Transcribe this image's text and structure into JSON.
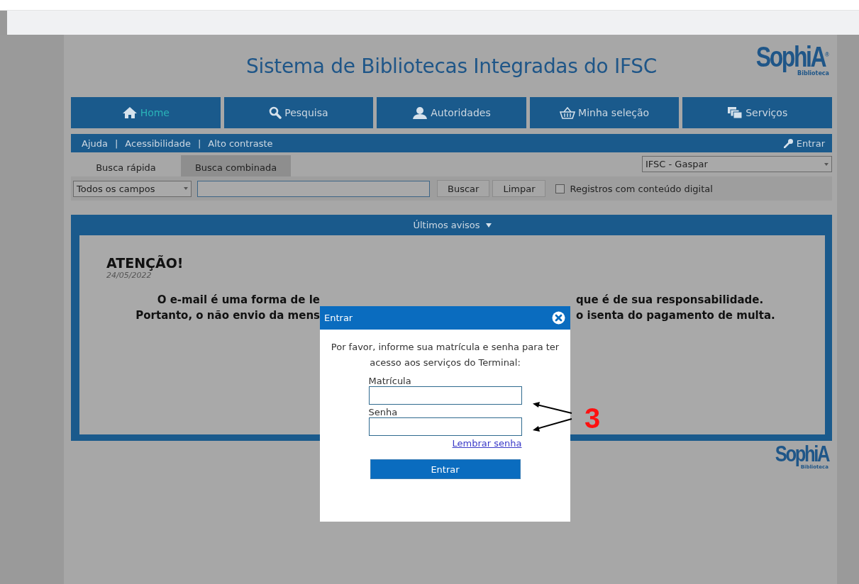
{
  "header": {
    "title": "Sistema de Bibliotecas Integradas do IFSC",
    "logo": {
      "name": "SophiA",
      "mark": "®",
      "sub": "Biblioteca"
    }
  },
  "nav": [
    {
      "label": "Home",
      "selected": true
    },
    {
      "label": "Pesquisa",
      "selected": false
    },
    {
      "label": "Autoridades",
      "selected": false
    },
    {
      "label": "Minha seleção",
      "selected": false
    },
    {
      "label": "Serviços",
      "selected": false
    }
  ],
  "links": [
    "Ajuda",
    "Acessibilidade",
    "Alto contraste"
  ],
  "link_separator": "|",
  "login_link": "Entrar",
  "search_tabs": [
    {
      "label": "Busca rápida",
      "selected": true
    },
    {
      "label": "Busca combinada",
      "selected": false
    }
  ],
  "library_select": "IFSC - Gaspar",
  "search": {
    "field_select": "Todos os campos",
    "buttons": [
      "Buscar",
      "Limpar"
    ],
    "digital_only": {
      "label": "Registros com conteúdo digital",
      "checked": false
    }
  },
  "notices": {
    "title": "Últimos avisos",
    "heading": "ATENÇÃO!",
    "date": "24/05/2022",
    "lines": [
      {
        "left": "O e-mail é uma forma de le",
        "right": "que é de sua responsabilidade."
      },
      {
        "left": "Portanto, o não envio da mens",
        "right": "o isenta do pagamento de multa."
      }
    ]
  },
  "footer_logo": {
    "name": "SophiA",
    "sub": "Biblioteca"
  },
  "dialog": {
    "title": "Entrar",
    "message": "Por favor, informe sua matrícula e senha para ter acesso aos serviços do Terminal:",
    "fields": [
      {
        "label": "Matrícula"
      },
      {
        "label": "Senha"
      }
    ],
    "forgot_link": "Lembrar senha",
    "submit": "Entrar"
  },
  "annotation": {
    "label": "3"
  }
}
